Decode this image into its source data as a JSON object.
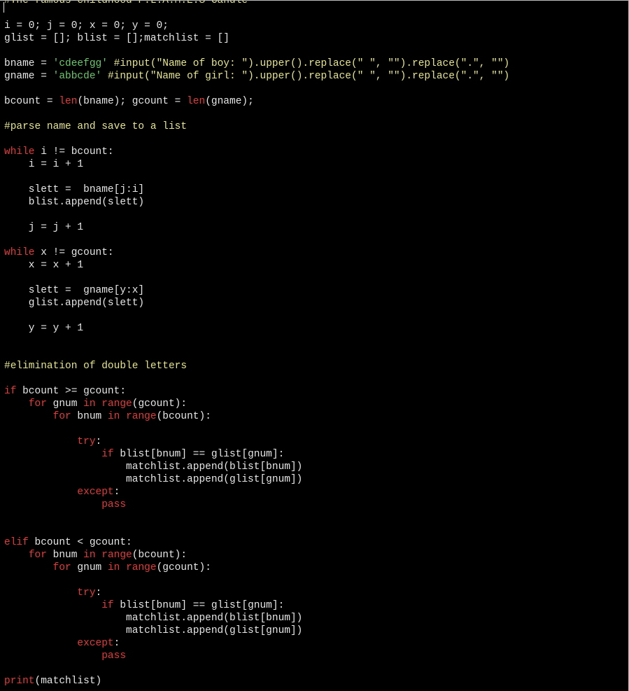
{
  "colors": {
    "background": "#000000",
    "default": "#e6e6e6",
    "keyword": "#e23b3b",
    "builtin": "#e23b3b",
    "comment": "#e5e58a",
    "string": "#69c96a"
  },
  "editor": {
    "language": "python",
    "lines": [
      [
        {
          "t": "comment",
          "v": "#The famous childhood F.L.A.M.E.S Candle"
        }
      ],
      [],
      [
        {
          "t": "default",
          "v": "i = 0; j = 0; x = 0; y = 0;"
        }
      ],
      [
        {
          "t": "default",
          "v": "glist = []; blist = [];matchlist = []"
        }
      ],
      [],
      [
        {
          "t": "default",
          "v": "bname = "
        },
        {
          "t": "string",
          "v": "'cdeefgg'"
        },
        {
          "t": "default",
          "v": " "
        },
        {
          "t": "comment",
          "v": "#input(\"Name of boy: \").upper().replace(\" \", \"\").replace(\".\", \"\")"
        }
      ],
      [
        {
          "t": "default",
          "v": "gname = "
        },
        {
          "t": "string",
          "v": "'abbcde'"
        },
        {
          "t": "default",
          "v": " "
        },
        {
          "t": "comment",
          "v": "#input(\"Name of girl: \").upper().replace(\" \", \"\").replace(\".\", \"\")"
        }
      ],
      [],
      [
        {
          "t": "default",
          "v": "bcount = "
        },
        {
          "t": "builtin",
          "v": "len"
        },
        {
          "t": "default",
          "v": "(bname); gcount = "
        },
        {
          "t": "builtin",
          "v": "len"
        },
        {
          "t": "default",
          "v": "(gname);"
        }
      ],
      [],
      [
        {
          "t": "comment",
          "v": "#parse name and save to a list"
        }
      ],
      [],
      [
        {
          "t": "keyword",
          "v": "while"
        },
        {
          "t": "default",
          "v": " i != bcount:"
        }
      ],
      [
        {
          "t": "default",
          "v": "    i = i + 1"
        }
      ],
      [],
      [
        {
          "t": "default",
          "v": "    slett =  bname[j:i]"
        }
      ],
      [
        {
          "t": "default",
          "v": "    blist.append(slett)"
        }
      ],
      [],
      [
        {
          "t": "default",
          "v": "    j = j + 1"
        }
      ],
      [],
      [
        {
          "t": "keyword",
          "v": "while"
        },
        {
          "t": "default",
          "v": " x != gcount:"
        }
      ],
      [
        {
          "t": "default",
          "v": "    x = x + 1"
        }
      ],
      [],
      [
        {
          "t": "default",
          "v": "    slett =  gname[y:x]"
        }
      ],
      [
        {
          "t": "default",
          "v": "    glist.append(slett)"
        }
      ],
      [],
      [
        {
          "t": "default",
          "v": "    y = y + 1"
        }
      ],
      [],
      [],
      [
        {
          "t": "comment",
          "v": "#elimination of double letters"
        }
      ],
      [],
      [
        {
          "t": "keyword",
          "v": "if"
        },
        {
          "t": "default",
          "v": " bcount >= gcount:"
        }
      ],
      [
        {
          "t": "default",
          "v": "    "
        },
        {
          "t": "keyword",
          "v": "for"
        },
        {
          "t": "default",
          "v": " gnum "
        },
        {
          "t": "keyword",
          "v": "in"
        },
        {
          "t": "default",
          "v": " "
        },
        {
          "t": "builtin",
          "v": "range"
        },
        {
          "t": "default",
          "v": "(gcount):"
        }
      ],
      [
        {
          "t": "default",
          "v": "        "
        },
        {
          "t": "keyword",
          "v": "for"
        },
        {
          "t": "default",
          "v": " bnum "
        },
        {
          "t": "keyword",
          "v": "in"
        },
        {
          "t": "default",
          "v": " "
        },
        {
          "t": "builtin",
          "v": "range"
        },
        {
          "t": "default",
          "v": "(bcount):"
        }
      ],
      [],
      [
        {
          "t": "default",
          "v": "            "
        },
        {
          "t": "keyword",
          "v": "try"
        },
        {
          "t": "default",
          "v": ":"
        }
      ],
      [
        {
          "t": "default",
          "v": "                "
        },
        {
          "t": "keyword",
          "v": "if"
        },
        {
          "t": "default",
          "v": " blist[bnum] == glist[gnum]:"
        }
      ],
      [
        {
          "t": "default",
          "v": "                    matchlist.append(blist[bnum])"
        }
      ],
      [
        {
          "t": "default",
          "v": "                    matchlist.append(glist[gnum])"
        }
      ],
      [
        {
          "t": "default",
          "v": "            "
        },
        {
          "t": "keyword",
          "v": "except"
        },
        {
          "t": "default",
          "v": ":"
        }
      ],
      [
        {
          "t": "default",
          "v": "                "
        },
        {
          "t": "keyword",
          "v": "pass"
        }
      ],
      [],
      [],
      [
        {
          "t": "keyword",
          "v": "elif"
        },
        {
          "t": "default",
          "v": " bcount < gcount:"
        }
      ],
      [
        {
          "t": "default",
          "v": "    "
        },
        {
          "t": "keyword",
          "v": "for"
        },
        {
          "t": "default",
          "v": " bnum "
        },
        {
          "t": "keyword",
          "v": "in"
        },
        {
          "t": "default",
          "v": " "
        },
        {
          "t": "builtin",
          "v": "range"
        },
        {
          "t": "default",
          "v": "(bcount):"
        }
      ],
      [
        {
          "t": "default",
          "v": "        "
        },
        {
          "t": "keyword",
          "v": "for"
        },
        {
          "t": "default",
          "v": " gnum "
        },
        {
          "t": "keyword",
          "v": "in"
        },
        {
          "t": "default",
          "v": " "
        },
        {
          "t": "builtin",
          "v": "range"
        },
        {
          "t": "default",
          "v": "(gcount):"
        }
      ],
      [],
      [
        {
          "t": "default",
          "v": "            "
        },
        {
          "t": "keyword",
          "v": "try"
        },
        {
          "t": "default",
          "v": ":"
        }
      ],
      [
        {
          "t": "default",
          "v": "                "
        },
        {
          "t": "keyword",
          "v": "if"
        },
        {
          "t": "default",
          "v": " blist[bnum] == glist[gnum]:"
        }
      ],
      [
        {
          "t": "default",
          "v": "                    matchlist.append(blist[bnum])"
        }
      ],
      [
        {
          "t": "default",
          "v": "                    matchlist.append(glist[gnum])"
        }
      ],
      [
        {
          "t": "default",
          "v": "            "
        },
        {
          "t": "keyword",
          "v": "except"
        },
        {
          "t": "default",
          "v": ":"
        }
      ],
      [
        {
          "t": "default",
          "v": "                "
        },
        {
          "t": "keyword",
          "v": "pass"
        }
      ],
      [],
      [
        {
          "t": "builtin",
          "v": "print"
        },
        {
          "t": "default",
          "v": "(matchlist)"
        }
      ]
    ]
  }
}
